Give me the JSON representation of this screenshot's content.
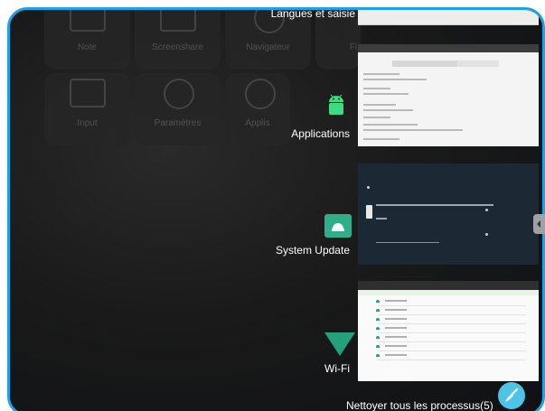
{
  "launcher": {
    "tiles": [
      {
        "label": "Note",
        "icon": "note-icon"
      },
      {
        "label": "Screenshare",
        "icon": "screenshare-icon"
      },
      {
        "label": "Navigateur",
        "icon": "browser-icon"
      },
      {
        "label": "Fi",
        "icon": "files-icon"
      },
      {
        "label": "Input",
        "icon": "input-icon"
      },
      {
        "label": "Paramètres",
        "icon": "settings-icon"
      },
      {
        "label": "Applis",
        "icon": "apps-icon"
      }
    ]
  },
  "recents": {
    "apps": [
      {
        "label": "Langues et saisie",
        "icon": "none"
      },
      {
        "label": "Applications",
        "icon": "android-icon"
      },
      {
        "label": "System Update",
        "icon": "system-update-icon"
      },
      {
        "label": "Wi-Fi",
        "icon": "wifi-icon"
      }
    ],
    "clear_all_label": "Nettoyer tous les processus(5)"
  },
  "colors": {
    "frame_border": "#1aa3e6",
    "accent_green": "#2fae8a",
    "clear_button": "#4fc3e6"
  }
}
